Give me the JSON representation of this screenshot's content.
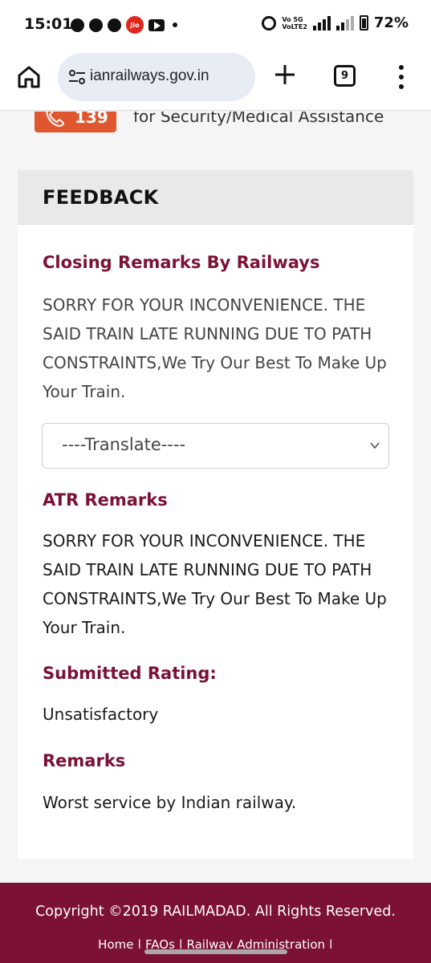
{
  "status_bar": {
    "time": "15:01",
    "jio_label": "Jio",
    "network_label": "Vo 5G\nVoLTE2",
    "network_5g": "5G",
    "battery": "72%"
  },
  "browser": {
    "url": "ianrailways.gov.in",
    "tab_count": "9"
  },
  "helpline": {
    "number": "139",
    "text": "for Security/Medical Assistance"
  },
  "feedback": {
    "title": "FEEDBACK",
    "closing_remarks_title": "Closing Remarks By Railways",
    "closing_remarks_text": "SORRY FOR YOUR INCONVENIENCE. THE SAID TRAIN LATE RUNNING DUE TO PATH CONSTRAINTS,We Try Our Best To Make Up Your Train.",
    "translate_selected": "----Translate----",
    "atr_remarks_title": "ATR Remarks",
    "atr_remarks_text": "SORRY FOR YOUR INCONVENIENCE. THE SAID TRAIN LATE RUNNING DUE TO PATH CONSTRAINTS,We Try Our Best To Make Up Your Train.",
    "submitted_rating_title": "Submitted Rating:",
    "submitted_rating_value": "Unsatisfactory",
    "remarks_title": "Remarks",
    "remarks_text": "Worst service by Indian railway."
  },
  "footer": {
    "copyright": "Copyright ©2019 RAILMADAD. All Rights Reserved.",
    "links": "Home | FAQs | Railway Administration |"
  },
  "colors": {
    "accent": "#7b1133",
    "helpline_badge": "#e0562e",
    "url_bar": "#e8ecf5",
    "card_header": "#e9e9e9"
  }
}
